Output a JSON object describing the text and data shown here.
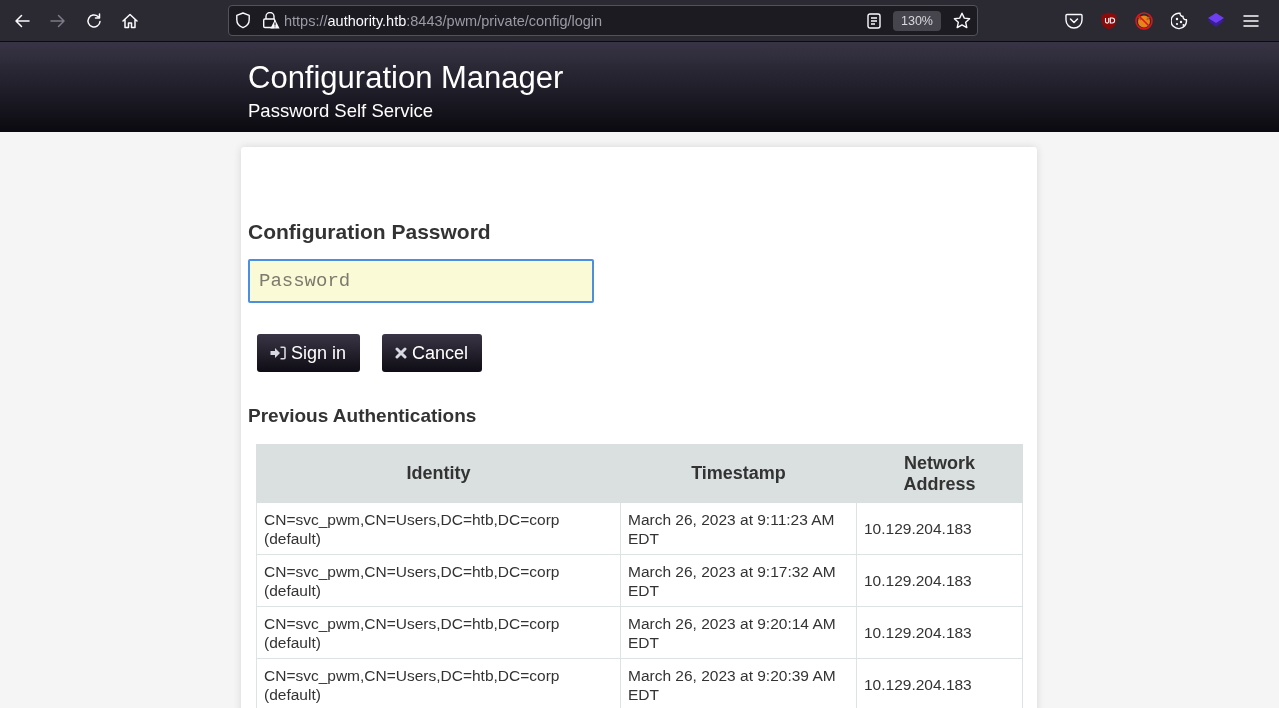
{
  "browser": {
    "nav_buttons": [
      {
        "kind": "back",
        "disabled": false
      },
      {
        "kind": "forward",
        "disabled": true
      },
      {
        "kind": "reload",
        "disabled": false
      },
      {
        "kind": "home",
        "disabled": false
      }
    ],
    "url": {
      "scheme": "https://",
      "host": "authority.htb",
      "path": ":8443/pwm/private/config/login"
    },
    "zoom": "130%"
  },
  "header": {
    "title": "Configuration Manager",
    "subtitle": "Password Self Service"
  },
  "login": {
    "heading": "Configuration Password",
    "password_field": {
      "placeholder": "Password",
      "focused": true
    },
    "buttons": [
      {
        "kind": "sign_in",
        "label": "Sign in"
      },
      {
        "kind": "cancel",
        "label": "Cancel"
      }
    ]
  },
  "history": {
    "heading": "Previous Authentications",
    "columns": [
      "Identity",
      "Timestamp",
      "Network Address"
    ],
    "rows": [
      {
        "identity": "CN=svc_pwm,CN=Users,DC=htb,DC=corp (default)",
        "timestamp": "March 26, 2023 at 9:11:23 AM EDT",
        "network_address": "10.129.204.183"
      },
      {
        "identity": "CN=svc_pwm,CN=Users,DC=htb,DC=corp (default)",
        "timestamp": "March 26, 2023 at 9:17:32 AM EDT",
        "network_address": "10.129.204.183"
      },
      {
        "identity": "CN=svc_pwm,CN=Users,DC=htb,DC=corp (default)",
        "timestamp": "March 26, 2023 at 9:20:14 AM EDT",
        "network_address": "10.129.204.183"
      },
      {
        "identity": "CN=svc_pwm,CN=Users,DC=htb,DC=corp (default)",
        "timestamp": "March 26, 2023 at 9:20:39 AM EDT",
        "network_address": "10.129.204.183"
      }
    ]
  }
}
